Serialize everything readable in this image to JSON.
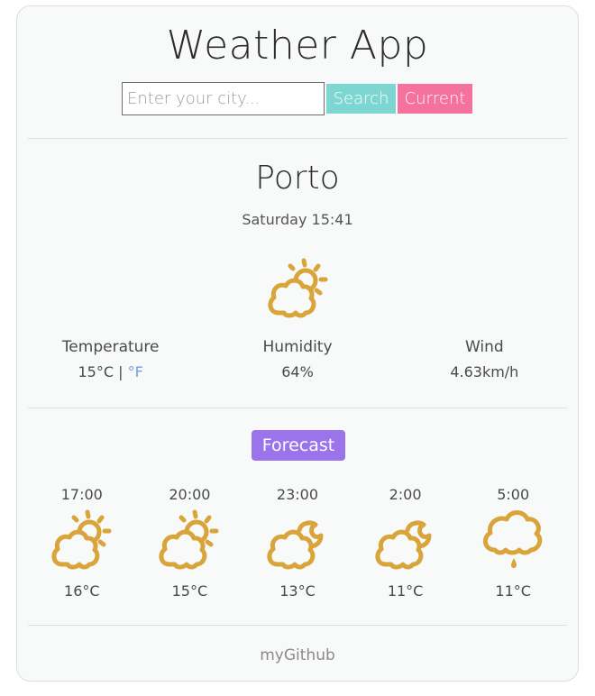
{
  "app": {
    "title": "Weather App"
  },
  "search": {
    "placeholder": "Enter your city...",
    "value": "",
    "search_label": "Search",
    "current_label": "Current"
  },
  "current": {
    "city": "Porto",
    "datetime": "Saturday 15:41",
    "icon": "partly-cloudy-day-icon",
    "temperature": {
      "label": "Temperature",
      "celsius": "15°C",
      "separator": "|",
      "fahrenheit_link": "°F"
    },
    "humidity": {
      "label": "Humidity",
      "value": "64%"
    },
    "wind": {
      "label": "Wind",
      "value": "4.63km/h"
    }
  },
  "forecast": {
    "label": "Forecast",
    "items": [
      {
        "time": "17:00",
        "icon": "partly-cloudy-day-icon",
        "temp": "16°C"
      },
      {
        "time": "20:00",
        "icon": "partly-cloudy-day-icon",
        "temp": "15°C"
      },
      {
        "time": "23:00",
        "icon": "partly-cloudy-night-icon",
        "temp": "13°C"
      },
      {
        "time": "2:00",
        "icon": "partly-cloudy-night-icon",
        "temp": "11°C"
      },
      {
        "time": "5:00",
        "icon": "rain-icon",
        "temp": "11°C"
      }
    ]
  },
  "footer": {
    "link": "myGithub"
  },
  "colors": {
    "search": "#7ed6d2",
    "current": "#f4729d",
    "forecast": "#9b74ec",
    "icon": "#d9a43a",
    "fahrenheit": "#6f9bea"
  }
}
